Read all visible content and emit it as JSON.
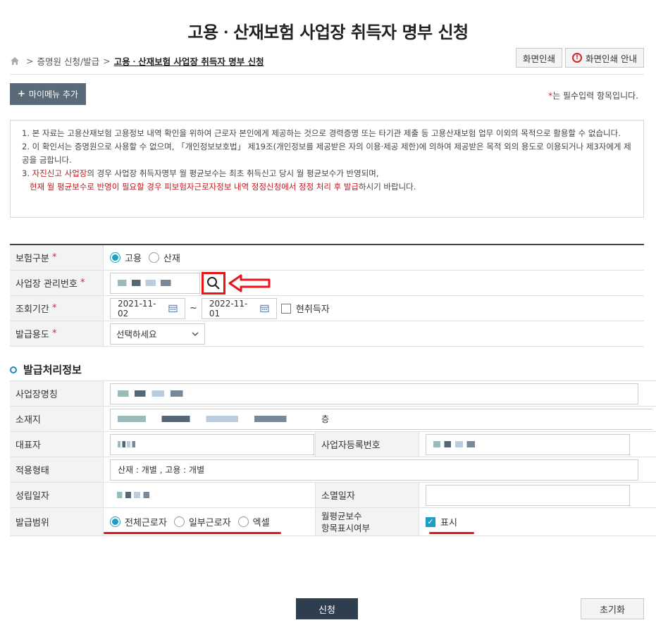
{
  "page_title": "고용ㆍ산재보험 사업장 취득자 명부 신청",
  "breadcrumb": {
    "level1": "증명원 신청/발급",
    "current": "고용ㆍ산재보험 사업장 취득자 명부 신청"
  },
  "top_buttons": {
    "print": "화면인쇄",
    "print_guide": "화면인쇄 안내"
  },
  "my_menu_add": "마이메뉴 추가",
  "required_note": "는 필수입력 항목입니다.",
  "notice": {
    "item1": "1. 본 자료는 고용산재보험 고용정보 내역 확인을 위하여 근로자 본인에게 제공하는 것으로 경력증명 또는 타기관 제출 등 고용산재보험 업무 이외의 목적으로 활용할 수 없습니다.",
    "item2": "2. 이 확인서는 증명원으로 사용할 수 없으며, 「개인정보보호법」 제19조(개인정보를 제공받은 자의 이용·제공 제한)에 의하여 제공받은 목적 외의 용도로 이용되거나 제3자에게 제공을 금합니다.",
    "item3_num": "3. ",
    "item3_red1": "자진신고",
    "item3_mid1": " ",
    "item3_red2": "사업장",
    "item3_rest": "의 경우 사업장 취득자명부 월 평균보수는 최초 취득신고 당시 월 평균보수가 반영되며,",
    "item3_line2_red": "현재 월 평균보수로 반영이 필요할 경우 피보험자근로자정보 내역 정정신청에서 정정 처리 후 발급",
    "item3_line2_rest": "하시기 바랍니다."
  },
  "form": {
    "insurance_type": {
      "label": "보험구분",
      "options": [
        "고용",
        "산재"
      ],
      "selected": "고용"
    },
    "biz_mgmt_no": {
      "label": "사업장 관리번호"
    },
    "period": {
      "label": "조회기간",
      "from": "2021-11-02",
      "to": "2022-11-01",
      "tilde": "~",
      "current_acquirer": "현취득자"
    },
    "purpose": {
      "label": "발급용도",
      "selected": "선택하세요"
    }
  },
  "issue_section": {
    "title": "발급처리정보",
    "biz_name": "사업장명칭",
    "address": "소재지",
    "address_tail": "층",
    "representative": "대표자",
    "biz_reg_no": "사업자등록번호",
    "apply_type": {
      "label": "적용형태",
      "value": "산재 : 개별 , 고용 : 개별"
    },
    "founded": "성립일자",
    "closed": "소멸일자",
    "scope": {
      "label": "발급범위",
      "options": [
        "전체근로자",
        "일부근로자",
        "엑셀"
      ],
      "selected": "전체근로자"
    },
    "wage_display": {
      "label_line1": "월평균보수",
      "label_line2": "항목표시여부",
      "checkbox": "표시",
      "checked": true
    }
  },
  "buttons": {
    "apply": "신청",
    "reset": "초기화"
  },
  "colors": {
    "accent": "#1aa0c7",
    "highlight_red": "#e8141a",
    "dark_button": "#2f3e4f"
  }
}
